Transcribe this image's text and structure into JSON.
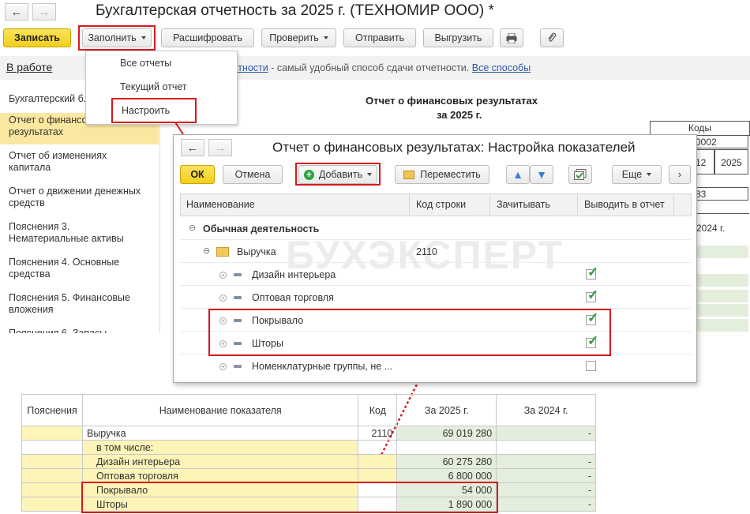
{
  "window": {
    "title": "Бухгалтерская отчетность за 2025 г. (ТЕХНОМИР ООО) *"
  },
  "toolbar": {
    "save": "Записать",
    "fill": "Заполнить",
    "decode": "Расшифровать",
    "check": "Проверить",
    "send": "Отправить",
    "export": "Выгрузить"
  },
  "fill_menu": {
    "items": [
      "Все отчеты",
      "Текущий отчет",
      "Настроить"
    ]
  },
  "status": {
    "in_work": "В работе",
    "link_prefix": "...тчетности",
    "text": " - самый удобный способ сдачи отчетности. ",
    "ways_link": "Все способы"
  },
  "sidebar": {
    "items": [
      "Бухгалтерский б...",
      "Отчет о финансовых результатах",
      "Отчет об изменениях капитала",
      "Отчет о движении денежных средств",
      "Пояснения 3. Нематериальные активы",
      "Пояснения 4. Основные средства",
      "Пояснения 5. Финансовые вложения",
      "Пояснения 6. Запасы"
    ]
  },
  "report": {
    "title": "Отчет о финансовых результатах",
    "subtitle": "за 2025 г.",
    "codes_header": "Коды",
    "code_1": "0002",
    "code_2": "12",
    "code_3": "2025",
    "code_4": "83",
    "col_2024": "2024 г."
  },
  "dialog": {
    "title": "Отчет о финансовых результатах: Настройка показателей",
    "ok": "ОК",
    "cancel": "Отмена",
    "add": "Добавить",
    "move": "Переместить",
    "more": "Еще",
    "columns": [
      "Наименование",
      "Код строки",
      "Зачитывать",
      "Выводить в отчет"
    ],
    "watermark": "БУХЭКСПЕРТ",
    "rows": [
      {
        "name": "Обычная деятельность",
        "code": "",
        "checked": null
      },
      {
        "name": "Выручка",
        "code": "2110",
        "checked": null
      },
      {
        "name": "Дизайн интерьера",
        "code": "",
        "checked": true
      },
      {
        "name": "Оптовая торговля",
        "code": "",
        "checked": true
      },
      {
        "name": "Покрывало",
        "code": "",
        "checked": true
      },
      {
        "name": "Шторы",
        "code": "",
        "checked": true
      },
      {
        "name": "Номенклатурные группы, не ...",
        "code": "",
        "checked": false
      }
    ]
  },
  "bottom_table": {
    "headers": [
      "Пояснения",
      "Наименование показателя",
      "Код",
      "За 2025 г.",
      "За 2024 г."
    ],
    "rows": [
      {
        "name": "Выручка",
        "code": "2110",
        "v2025": "69 019 280",
        "v2024": "-"
      },
      {
        "name": "в том числе:",
        "code": "",
        "v2025": "",
        "v2024": ""
      },
      {
        "name": "Дизайн интерьера",
        "code": "",
        "v2025": "60 275 280",
        "v2024": "-"
      },
      {
        "name": "Оптовая торговля",
        "code": "",
        "v2025": "6 800 000",
        "v2024": "-"
      },
      {
        "name": "Покрывало",
        "code": "",
        "v2025": "54 000",
        "v2024": "-"
      },
      {
        "name": "Шторы",
        "code": "",
        "v2025": "1 890 000",
        "v2024": "-"
      }
    ]
  }
}
